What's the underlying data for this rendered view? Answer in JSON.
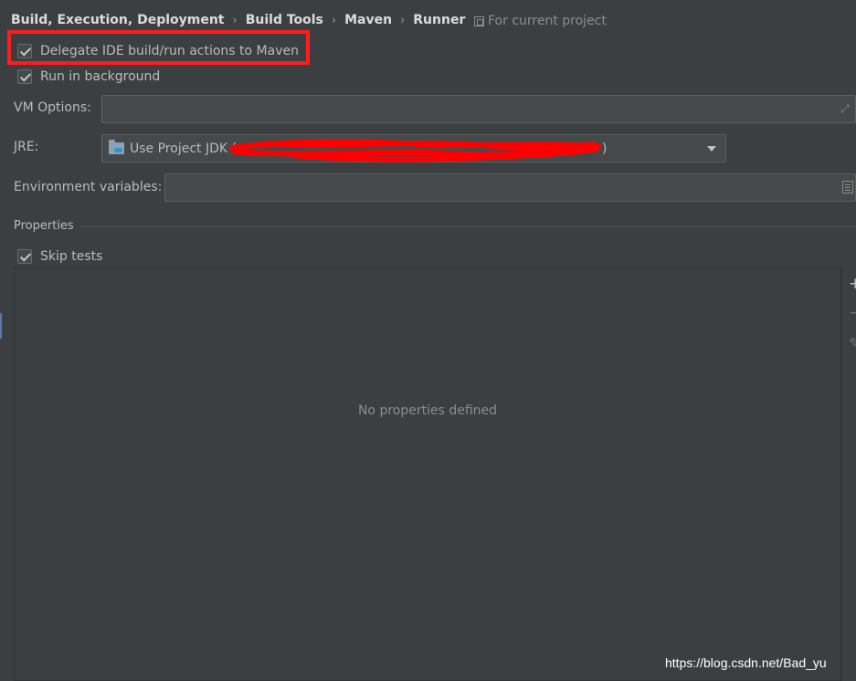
{
  "breadcrumb": [
    "Build, Execution, Deployment",
    "Build Tools",
    "Maven",
    "Runner"
  ],
  "scope_label": "For current project",
  "options": {
    "delegate_label": "Delegate IDE build/run actions to Maven",
    "delegate_checked": true,
    "background_label": "Run in background",
    "background_checked": true
  },
  "vm_options": {
    "label": "VM Options:",
    "value": ""
  },
  "jre": {
    "label": "JRE:",
    "selected": "Use Project JDK (",
    "selected_tail": ")",
    "icon": "folder-icon"
  },
  "env_vars": {
    "label": "Environment variables:",
    "value": ""
  },
  "properties": {
    "section_title": "Properties",
    "skip_tests_label": "Skip tests",
    "skip_tests_checked": true,
    "empty_text": "No properties defined",
    "toolbar": {
      "add": "+",
      "remove": "−",
      "edit": "✎"
    }
  },
  "watermark": "https://blog.csdn.net/Bad_yu",
  "colors": {
    "background": "#3c3f41",
    "field": "#45494a",
    "highlight": "#ff1c1c",
    "scribble": "#ff0000"
  }
}
